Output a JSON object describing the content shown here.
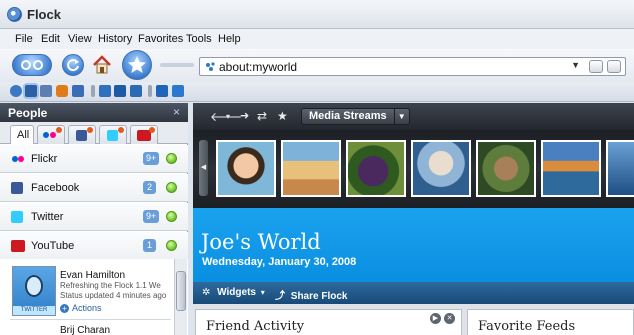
{
  "window": {
    "title": "Flock"
  },
  "menu": [
    "File",
    "Edit",
    "View",
    "History",
    "Favorites",
    "Tools",
    "Help"
  ],
  "address_bar": {
    "url": "about:myworld"
  },
  "sidebar": {
    "title": "People",
    "close_glyph": "×",
    "tabs": [
      {
        "label": "All",
        "selected": true
      },
      {
        "icon": "flickr-icon"
      },
      {
        "icon": "facebook-icon"
      },
      {
        "icon": "twitter-icon"
      },
      {
        "icon": "youtube-icon"
      }
    ],
    "services": [
      {
        "name": "Flickr",
        "count": "9+",
        "icon": "flickr-icon",
        "color": "#ff0084"
      },
      {
        "name": "Facebook",
        "count": "2",
        "icon": "facebook-icon",
        "color": "#3b5998"
      },
      {
        "name": "Twitter",
        "count": "9+",
        "icon": "twitter-icon",
        "color": "#33ccff"
      },
      {
        "name": "YouTube",
        "count": "1",
        "icon": "youtube-icon",
        "color": "#cc181e"
      }
    ],
    "friends": [
      {
        "name": "Evan Hamilton",
        "status_line1": "Refreshing the Flock 1.1 We",
        "status_line2": "Status updated 4 minutes ago",
        "actions_label": "Actions",
        "avatar_tag": "TWITTER"
      },
      {
        "name": "Brij Charan"
      }
    ]
  },
  "main": {
    "toolbar": {
      "media_streams_label": "Media Streams"
    },
    "hero": {
      "title": "Joe's World",
      "date": "Wednesday, January 30, 2008"
    },
    "widgets_bar": {
      "widgets_label": "Widgets",
      "share_label": "Share Flock"
    },
    "panels": [
      {
        "title": "Friend Activity"
      },
      {
        "title": "Favorite Feeds"
      }
    ]
  },
  "colors": {
    "hero_blue": "#0a8fe0",
    "widgets_bar": "#174a77",
    "status_green": "#6cbe2a",
    "count_badge": "#6a9ed8"
  }
}
